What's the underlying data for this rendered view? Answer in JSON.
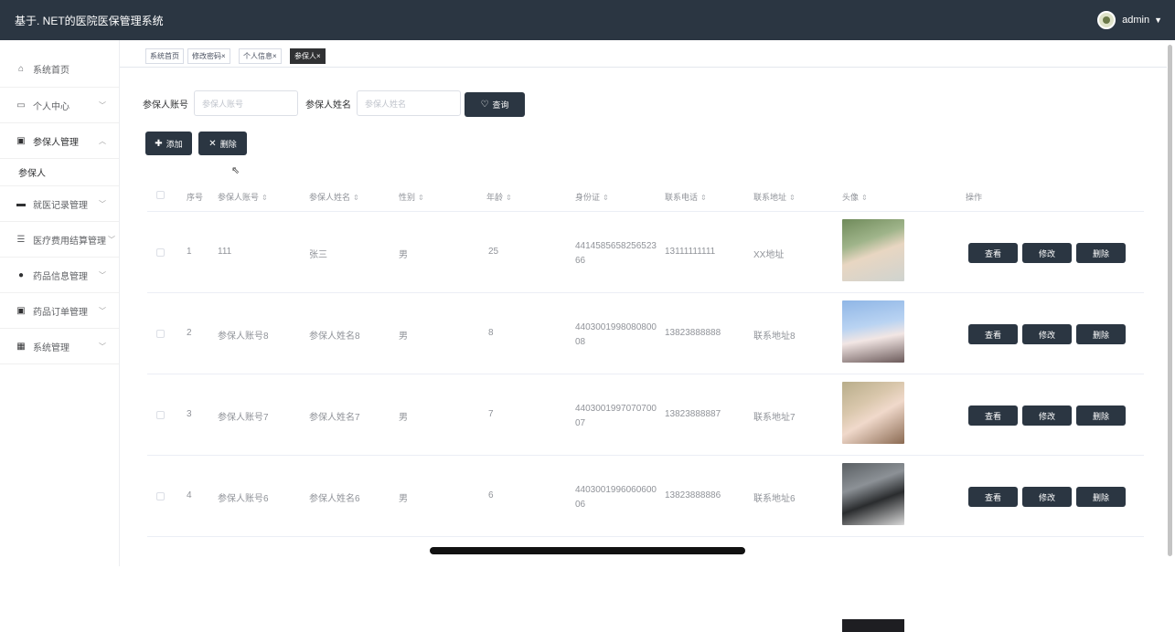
{
  "app": {
    "title": "基于. NET的医院医保管理系统",
    "user": "admin"
  },
  "sidebar": {
    "items": [
      {
        "label": "系统首页",
        "icon": "home-icon"
      },
      {
        "label": "个人中心",
        "icon": "card-icon"
      },
      {
        "label": "参保人管理",
        "icon": "clipboard-icon"
      },
      {
        "label": "就医记录管理",
        "icon": "record-icon"
      },
      {
        "label": "医疗费用结算管理",
        "icon": "sliders-icon"
      },
      {
        "label": "药品信息管理",
        "icon": "person-icon"
      },
      {
        "label": "药品订单管理",
        "icon": "clipboard-icon"
      },
      {
        "label": "系统管理",
        "icon": "grid-icon"
      }
    ],
    "sub_item": "参保人"
  },
  "tabs": [
    "系统首页",
    "修改密码×",
    "个人信息×",
    "参保人×"
  ],
  "search": {
    "account_label": "参保人账号",
    "account_placeholder": "参保人账号",
    "name_label": "参保人姓名",
    "name_placeholder": "参保人姓名",
    "query_label": "查询"
  },
  "actions": {
    "add": "添加",
    "delete": "删除"
  },
  "table": {
    "headers": [
      "序号",
      "参保人账号",
      "参保人姓名",
      "性别",
      "年龄",
      "身份证",
      "联系电话",
      "联系地址",
      "头像",
      "操作"
    ],
    "row_buttons": {
      "view": "查看",
      "edit": "修改",
      "delete": "删除"
    },
    "rows": [
      {
        "no": "1",
        "account": "111",
        "name": "张三",
        "gender": "男",
        "age": "25",
        "idcard": "441458565825652366",
        "phone": "13111111111",
        "address": "XX地址",
        "avatar": "avatar-photo-1"
      },
      {
        "no": "2",
        "account": "参保人账号8",
        "name": "参保人姓名8",
        "gender": "男",
        "age": "8",
        "idcard": "440300199808080008",
        "phone": "13823888888",
        "address": "联系地址8",
        "avatar": "avatar-photo-2"
      },
      {
        "no": "3",
        "account": "参保人账号7",
        "name": "参保人姓名7",
        "gender": "男",
        "age": "7",
        "idcard": "440300199707070007",
        "phone": "13823888887",
        "address": "联系地址7",
        "avatar": "avatar-photo-3"
      },
      {
        "no": "4",
        "account": "参保人账号6",
        "name": "参保人姓名6",
        "gender": "男",
        "age": "6",
        "idcard": "440300199606060006",
        "phone": "13823888886",
        "address": "联系地址6",
        "avatar": "avatar-photo-4"
      }
    ]
  },
  "colors": {
    "topbar": "#2b3642",
    "button": "#2b3642"
  }
}
